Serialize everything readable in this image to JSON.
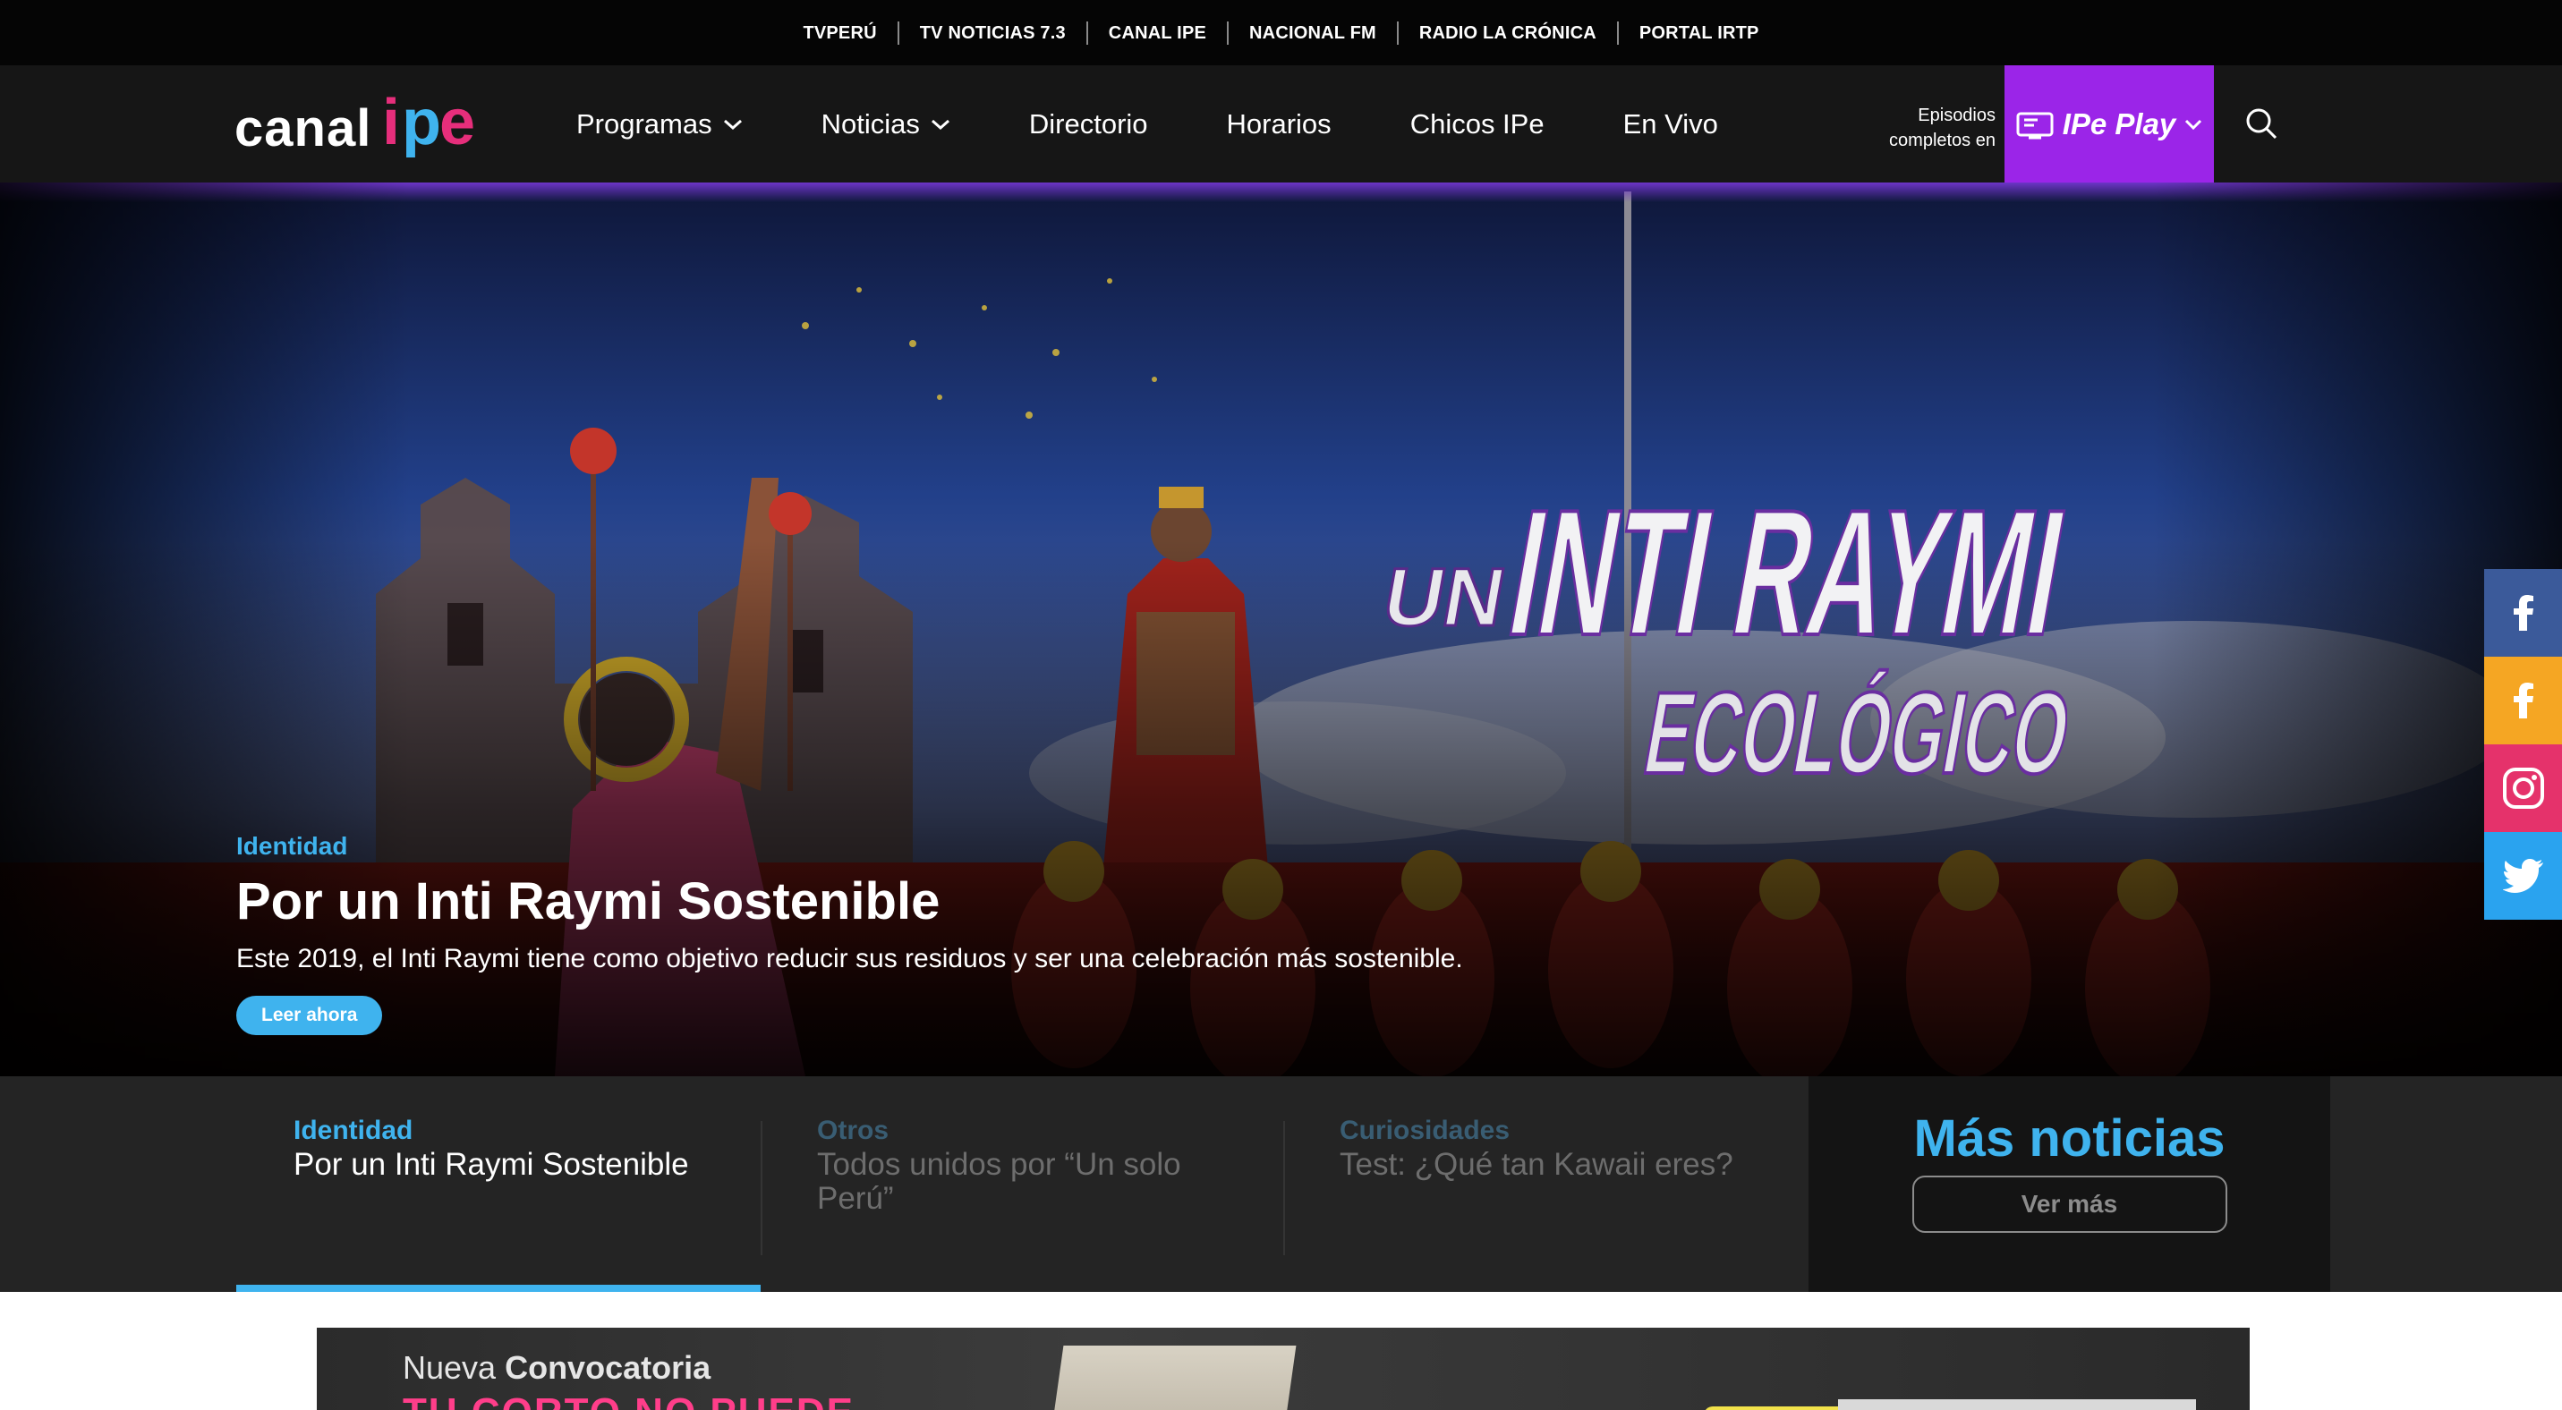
{
  "network": [
    "TVPERÚ",
    "TV NOTICIAS 7.3",
    "CANAL IPE",
    "NACIONAL FM",
    "RADIO LA CRÓNICA",
    "PORTAL IRTP"
  ],
  "header": {
    "logo_text": "canal",
    "logo_mark": "ipe",
    "nav": [
      {
        "label": "Programas",
        "dropdown": true
      },
      {
        "label": "Noticias",
        "dropdown": true
      },
      {
        "label": "Directorio",
        "dropdown": false
      },
      {
        "label": "Horarios",
        "dropdown": false
      },
      {
        "label": "Chicos IPe",
        "dropdown": false
      },
      {
        "label": "En Vivo",
        "dropdown": false
      }
    ],
    "episodes_line1": "Episodios",
    "episodes_line2": "completos en",
    "ipe_play": "IPe Play"
  },
  "hero": {
    "art_title_small": "UN",
    "art_title_big": "INTI RAYMI",
    "art_title_sub": "ECOLÓGICO",
    "category": "Identidad",
    "title": "Por un Inti Raymi Sostenible",
    "description": "Este 2019, el Inti Raymi tiene como objetivo reducir sus residuos y ser una celebración más sostenible.",
    "button": "Leer ahora"
  },
  "social": [
    {
      "name": "facebook-icon",
      "color": "#3b5a9a"
    },
    {
      "name": "facebook-icon",
      "color": "#f5a623"
    },
    {
      "name": "instagram-icon",
      "color": "#e5326b"
    },
    {
      "name": "twitter-icon",
      "color": "#2aa3ef"
    }
  ],
  "tabs": [
    {
      "category": "Identidad",
      "title": "Por un Inti Raymi Sostenible",
      "active": true
    },
    {
      "category": "Otros",
      "title": "Todos unidos por “Un solo Perú”",
      "active": false
    },
    {
      "category": "Curiosidades",
      "title": "Test: ¿Qué tan Kawaii eres?",
      "active": false
    }
  ],
  "more": {
    "heading": "Más noticias",
    "button": "Ver más"
  },
  "banner": {
    "line1_prefix": "Nueva",
    "line1_bold": "Convocatoria",
    "line2": "TU CORTO NO PUEDE"
  },
  "colors": {
    "accent": "#3fb3ee",
    "play": "#9b25e8",
    "logo_pink": "#e62e7b"
  }
}
